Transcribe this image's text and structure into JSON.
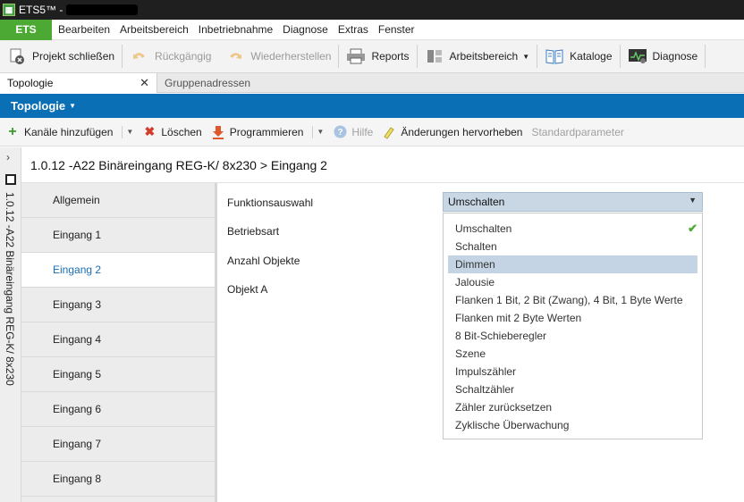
{
  "window": {
    "title": "ETS5™ -"
  },
  "menubar": {
    "ets_label": "ETS",
    "items": [
      "Bearbeiten",
      "Arbeitsbereich",
      "Inbetriebnahme",
      "Diagnose",
      "Extras",
      "Fenster"
    ]
  },
  "toolbar": {
    "close_project": "Projekt schließen",
    "undo": "Rückgängig",
    "redo": "Wiederherstellen",
    "reports": "Reports",
    "workspace": "Arbeitsbereich",
    "catalogs": "Kataloge",
    "diagnose": "Diagnose"
  },
  "tabs": [
    {
      "label": "Topologie",
      "active": true
    },
    {
      "label": "Gruppenadressen",
      "active": false
    }
  ],
  "panel": {
    "title": "Topologie"
  },
  "toolbar2": {
    "add_channels": "Kanäle hinzufügen",
    "delete": "Löschen",
    "program": "Programmieren",
    "help": "Hilfe",
    "highlight_changes": "Änderungen hervorheben",
    "default_params": "Standardparameter"
  },
  "sidestrip": {
    "device_label": "1.0.12 -A22 Binäreingang REG-K/ 8x230"
  },
  "breadcrumb": "1.0.12 -A22 Binäreingang REG-K/ 8x230 > Eingang 2",
  "nav": {
    "items": [
      {
        "label": "Allgemein"
      },
      {
        "label": "Eingang 1"
      },
      {
        "label": "Eingang 2"
      },
      {
        "label": "Eingang 3"
      },
      {
        "label": "Eingang 4"
      },
      {
        "label": "Eingang 5"
      },
      {
        "label": "Eingang 6"
      },
      {
        "label": "Eingang 7"
      },
      {
        "label": "Eingang 8"
      }
    ],
    "active_index": 2
  },
  "params": {
    "labels": [
      "Funktionsauswahl",
      "Betriebsart",
      "Anzahl Objekte",
      "Objekt A"
    ]
  },
  "dropdown": {
    "selected": "Umschalten",
    "options": [
      "Umschalten",
      "Schalten",
      "Dimmen",
      "Jalousie",
      "Flanken 1 Bit, 2 Bit (Zwang), 4 Bit, 1 Byte Werte",
      "Flanken mit 2 Byte Werten",
      "8 Bit-Schieberegler",
      "Szene",
      "Impulszähler",
      "Schaltzähler",
      "Zähler zurücksetzen",
      "Zyklische Überwachung"
    ],
    "checked_index": 0,
    "hover_index": 2
  },
  "colors": {
    "accent_blue": "#0a6fb4",
    "ets_green": "#4caa34",
    "dropdown_bg": "#c9d7e5",
    "hover_bg": "#c5d4e4"
  }
}
